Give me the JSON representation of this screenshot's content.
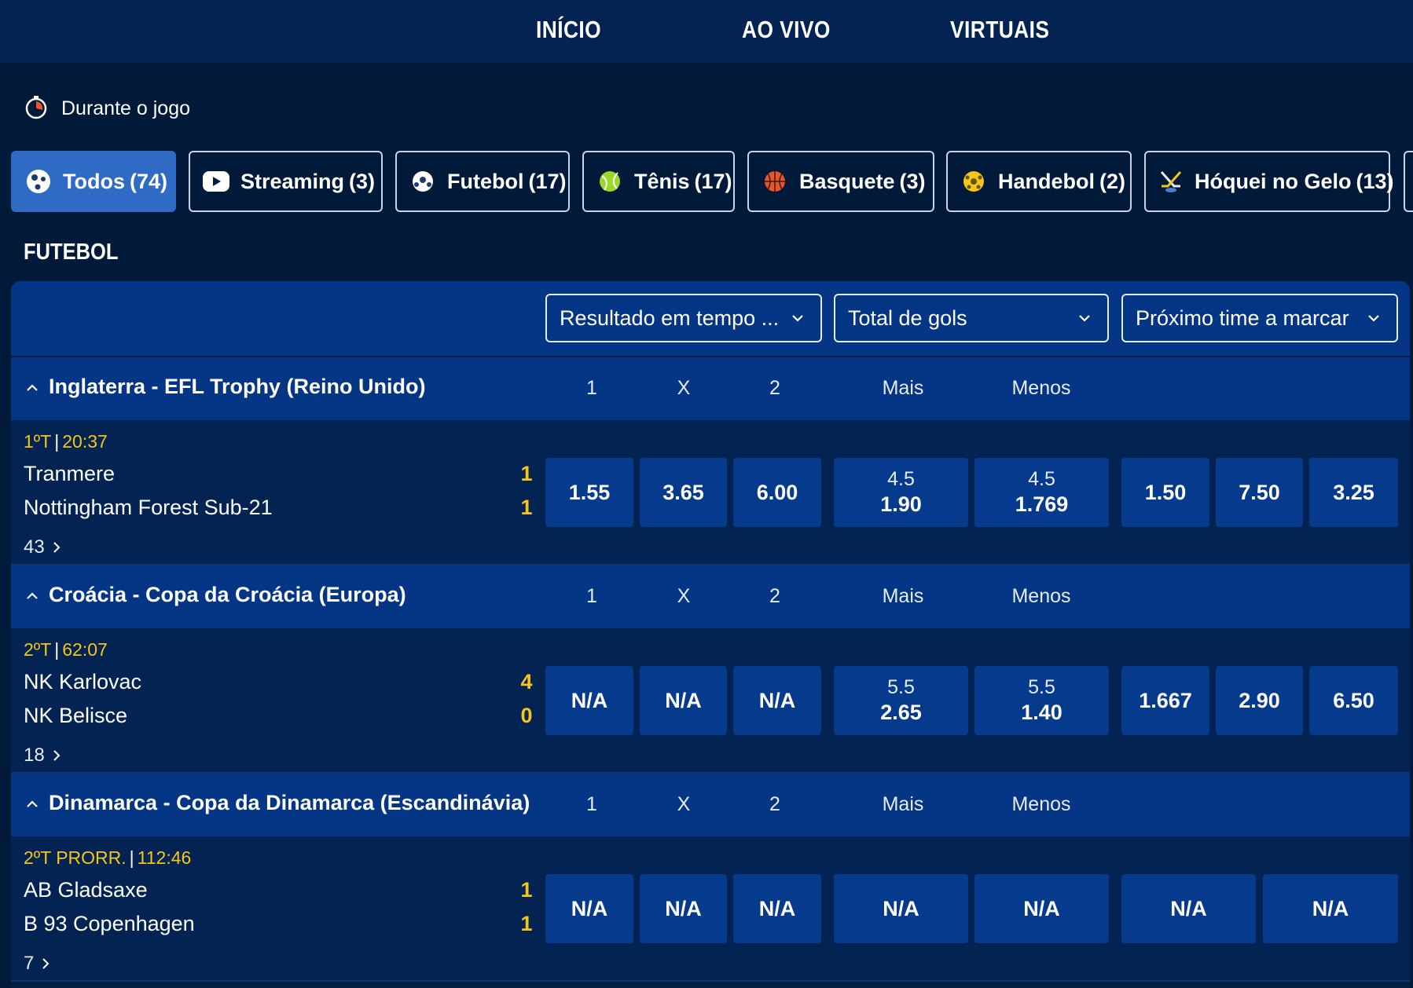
{
  "nav": {
    "items": [
      "INÍCIO",
      "AO VIVO",
      "VIRTUAIS"
    ]
  },
  "live": {
    "title": "Durante o jogo"
  },
  "filters": [
    {
      "label": "Todos",
      "count": "(74)",
      "icon": "soccer-balls-icon",
      "active": true
    },
    {
      "label": "Streaming",
      "count": "(3)",
      "icon": "play-icon",
      "active": false
    },
    {
      "label": "Futebol",
      "count": "(17)",
      "icon": "soccer-ball-icon",
      "active": false
    },
    {
      "label": "Tênis",
      "count": "(17)",
      "icon": "tennis-ball-icon",
      "active": false
    },
    {
      "label": "Basquete",
      "count": "(3)",
      "icon": "basketball-icon",
      "active": false
    },
    {
      "label": "Handebol",
      "count": "(2)",
      "icon": "handball-icon",
      "active": false
    },
    {
      "label": "Hóquei no Gelo",
      "count": "(13)",
      "icon": "ice-hockey-icon",
      "active": false
    }
  ],
  "section_title": "FUTEBOL",
  "market_selects": [
    "Resultado em tempo ...",
    "Total de gols",
    "Próximo time a marcar"
  ],
  "columns": {
    "c1": "1",
    "cx": "X",
    "c2": "2",
    "over": "Mais",
    "under": "Menos"
  },
  "leagues": [
    {
      "name": "Inglaterra - EFL Trophy (Reino Unido)",
      "period": "1ºT",
      "clock": "20:37",
      "home": "Tranmere",
      "away": "Nottingham Forest Sub-21",
      "home_score": "1",
      "away_score": "1",
      "more": "43",
      "odds_1x2": [
        "1.55",
        "3.65",
        "6.00"
      ],
      "total_line_over": "4.5",
      "total_over": "1.90",
      "total_line_under": "4.5",
      "total_under": "1.769",
      "next_goal": [
        "1.50",
        "7.50",
        "3.25"
      ]
    },
    {
      "name": "Croácia - Copa da Croácia (Europa)",
      "period": "2ºT",
      "clock": "62:07",
      "home": "NK Karlovac",
      "away": "NK Belisce",
      "home_score": "4",
      "away_score": "0",
      "more": "18",
      "odds_1x2": [
        "N/A",
        "N/A",
        "N/A"
      ],
      "total_line_over": "5.5",
      "total_over": "2.65",
      "total_line_under": "5.5",
      "total_under": "1.40",
      "next_goal": [
        "1.667",
        "2.90",
        "6.50"
      ]
    },
    {
      "name": "Dinamarca - Copa da Dinamarca (Escandinávia)",
      "period": "2ºT PRORR.",
      "clock": "112:46",
      "home": "AB Gladsaxe",
      "away": "B 93 Copenhagen",
      "home_score": "1",
      "away_score": "1",
      "more": "7",
      "odds_1x2": [
        "N/A",
        "N/A",
        "N/A"
      ],
      "total_over": "N/A",
      "total_under": "N/A",
      "next_goal": [
        "N/A",
        "N/A"
      ]
    }
  ],
  "colors": {
    "background": "#021a3a",
    "accent": "#2f6bc4",
    "score": "#f5c518",
    "odd_button": "#063a8d"
  }
}
